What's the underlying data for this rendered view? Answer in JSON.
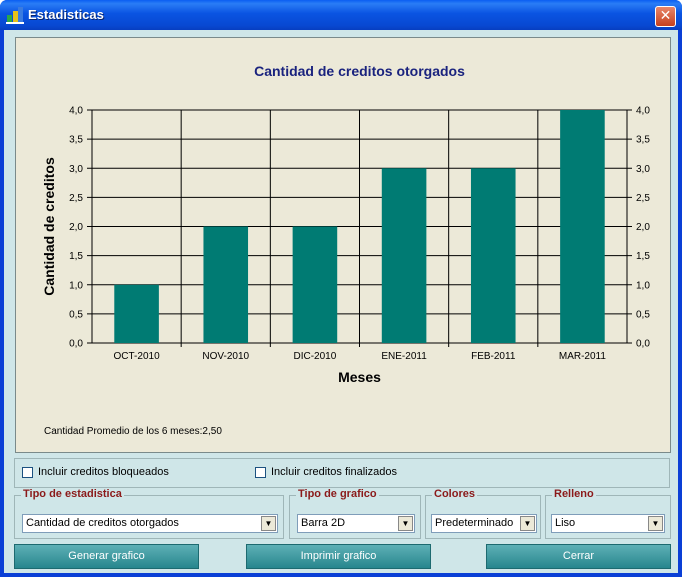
{
  "window": {
    "title": "Estadisticas",
    "close_glyph": "✕"
  },
  "chart_data": {
    "type": "bar",
    "title": "Cantidad de creditos otorgados",
    "xlabel": "Meses",
    "ylabel": "Cantidad de creditos",
    "categories": [
      "OCT-2010",
      "NOV-2010",
      "DIC-2010",
      "ENE-2011",
      "FEB-2011",
      "MAR-2011"
    ],
    "values": [
      1,
      2,
      2,
      3,
      3,
      4
    ],
    "ylim": [
      0,
      4
    ],
    "yticks": [
      "0,0",
      "0,5",
      "1,0",
      "1,5",
      "2,0",
      "2,5",
      "3,0",
      "3,5",
      "4,0"
    ],
    "bar_color": "#007b73",
    "grid": true,
    "legend": "none"
  },
  "average_text": "Cantidad Promedio de los 6 meses:2,50",
  "options": {
    "blocked_label": "Incluir creditos bloqueados",
    "finished_label": "Incluir creditos finalizados"
  },
  "groups": {
    "stat_type": {
      "legend": "Tipo de estadistica",
      "value": "Cantidad de creditos otorgados"
    },
    "chart_type": {
      "legend": "Tipo de grafico",
      "value": "Barra 2D"
    },
    "colors": {
      "legend": "Colores",
      "value": "Predeterminado"
    },
    "fill": {
      "legend": "Relleno",
      "value": "Liso"
    }
  },
  "buttons": {
    "generate": "Generar grafico",
    "print": "Imprimir grafico",
    "close": "Cerrar"
  }
}
